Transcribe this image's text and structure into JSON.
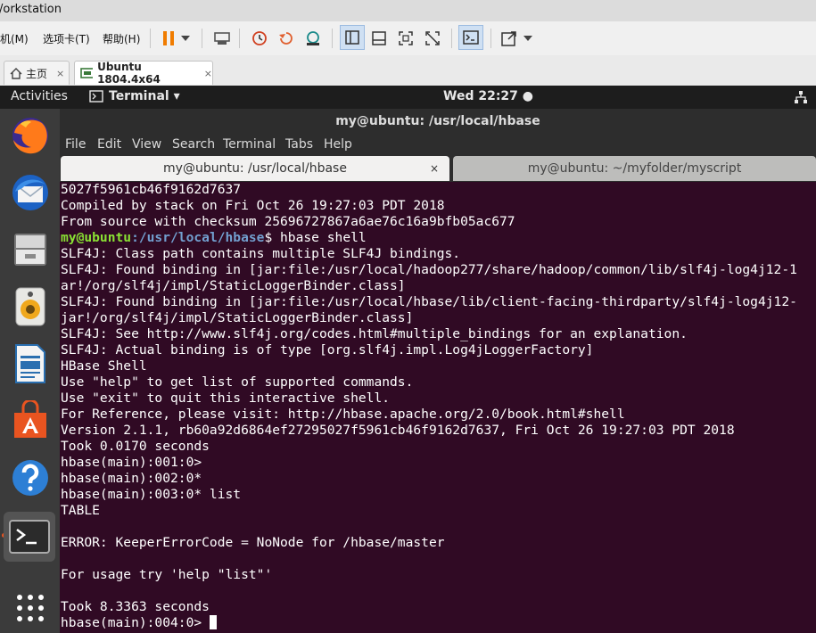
{
  "vmware": {
    "title": "/orkstation",
    "menus": [
      "机(M)",
      "选项卡(T)",
      "帮助(H)"
    ],
    "tabs": [
      {
        "label": "主页",
        "close": "×"
      },
      {
        "label": "Ubuntu 1804.4x64",
        "close": "×"
      }
    ]
  },
  "ubuntu_topbar": {
    "activities": "Activities",
    "app_menu": "Terminal ▾",
    "clock": "Wed 22:27 ●"
  },
  "dock": {
    "items": [
      "firefox-icon",
      "thunderbird-icon",
      "files-icon",
      "rhythmbox-icon",
      "writer-icon",
      "software-icon",
      "help-icon",
      "terminal-icon",
      "app-grid-icon"
    ]
  },
  "terminal": {
    "window_title": "my@ubuntu: /usr/local/hbase",
    "menu": [
      "File",
      "Edit",
      "View",
      "Search",
      "Terminal",
      "Tabs",
      "Help"
    ],
    "tabs": [
      {
        "label": "my@ubuntu: /usr/local/hbase",
        "close": "×"
      },
      {
        "label": "my@ubuntu: ~/myfolder/myscript"
      }
    ],
    "prompt_user": "my@ubuntu",
    "prompt_path": ":/usr/local/hbase",
    "prompt_cmd": "$ hbase shell",
    "lines_before": [
      "5027f5961cb46f9162d7637",
      "Compiled by stack on Fri Oct 26 19:27:03 PDT 2018",
      "From source with checksum 25696727867a6ae76c16a9bfb05ac677"
    ],
    "lines_after": [
      "SLF4J: Class path contains multiple SLF4J bindings.",
      "SLF4J: Found binding in [jar:file:/usr/local/hadoop277/share/hadoop/common/lib/slf4j-log4j12-1",
      "ar!/org/slf4j/impl/StaticLoggerBinder.class]",
      "SLF4J: Found binding in [jar:file:/usr/local/hbase/lib/client-facing-thirdparty/slf4j-log4j12-",
      "jar!/org/slf4j/impl/StaticLoggerBinder.class]",
      "SLF4J: See http://www.slf4j.org/codes.html#multiple_bindings for an explanation.",
      "SLF4J: Actual binding is of type [org.slf4j.impl.Log4jLoggerFactory]",
      "HBase Shell",
      "Use \"help\" to get list of supported commands.",
      "Use \"exit\" to quit this interactive shell.",
      "For Reference, please visit: http://hbase.apache.org/2.0/book.html#shell",
      "Version 2.1.1, rb60a92d6864ef27295027f5961cb46f9162d7637, Fri Oct 26 19:27:03 PDT 2018",
      "Took 0.0170 seconds",
      "hbase(main):001:0>",
      "hbase(main):002:0*",
      "hbase(main):003:0* list",
      "TABLE",
      "",
      "ERROR: KeeperErrorCode = NoNode for /hbase/master",
      "",
      "For usage try 'help \"list\"'",
      "",
      "Took 8.3363 seconds"
    ],
    "current_prompt": "hbase(main):004:0> "
  }
}
